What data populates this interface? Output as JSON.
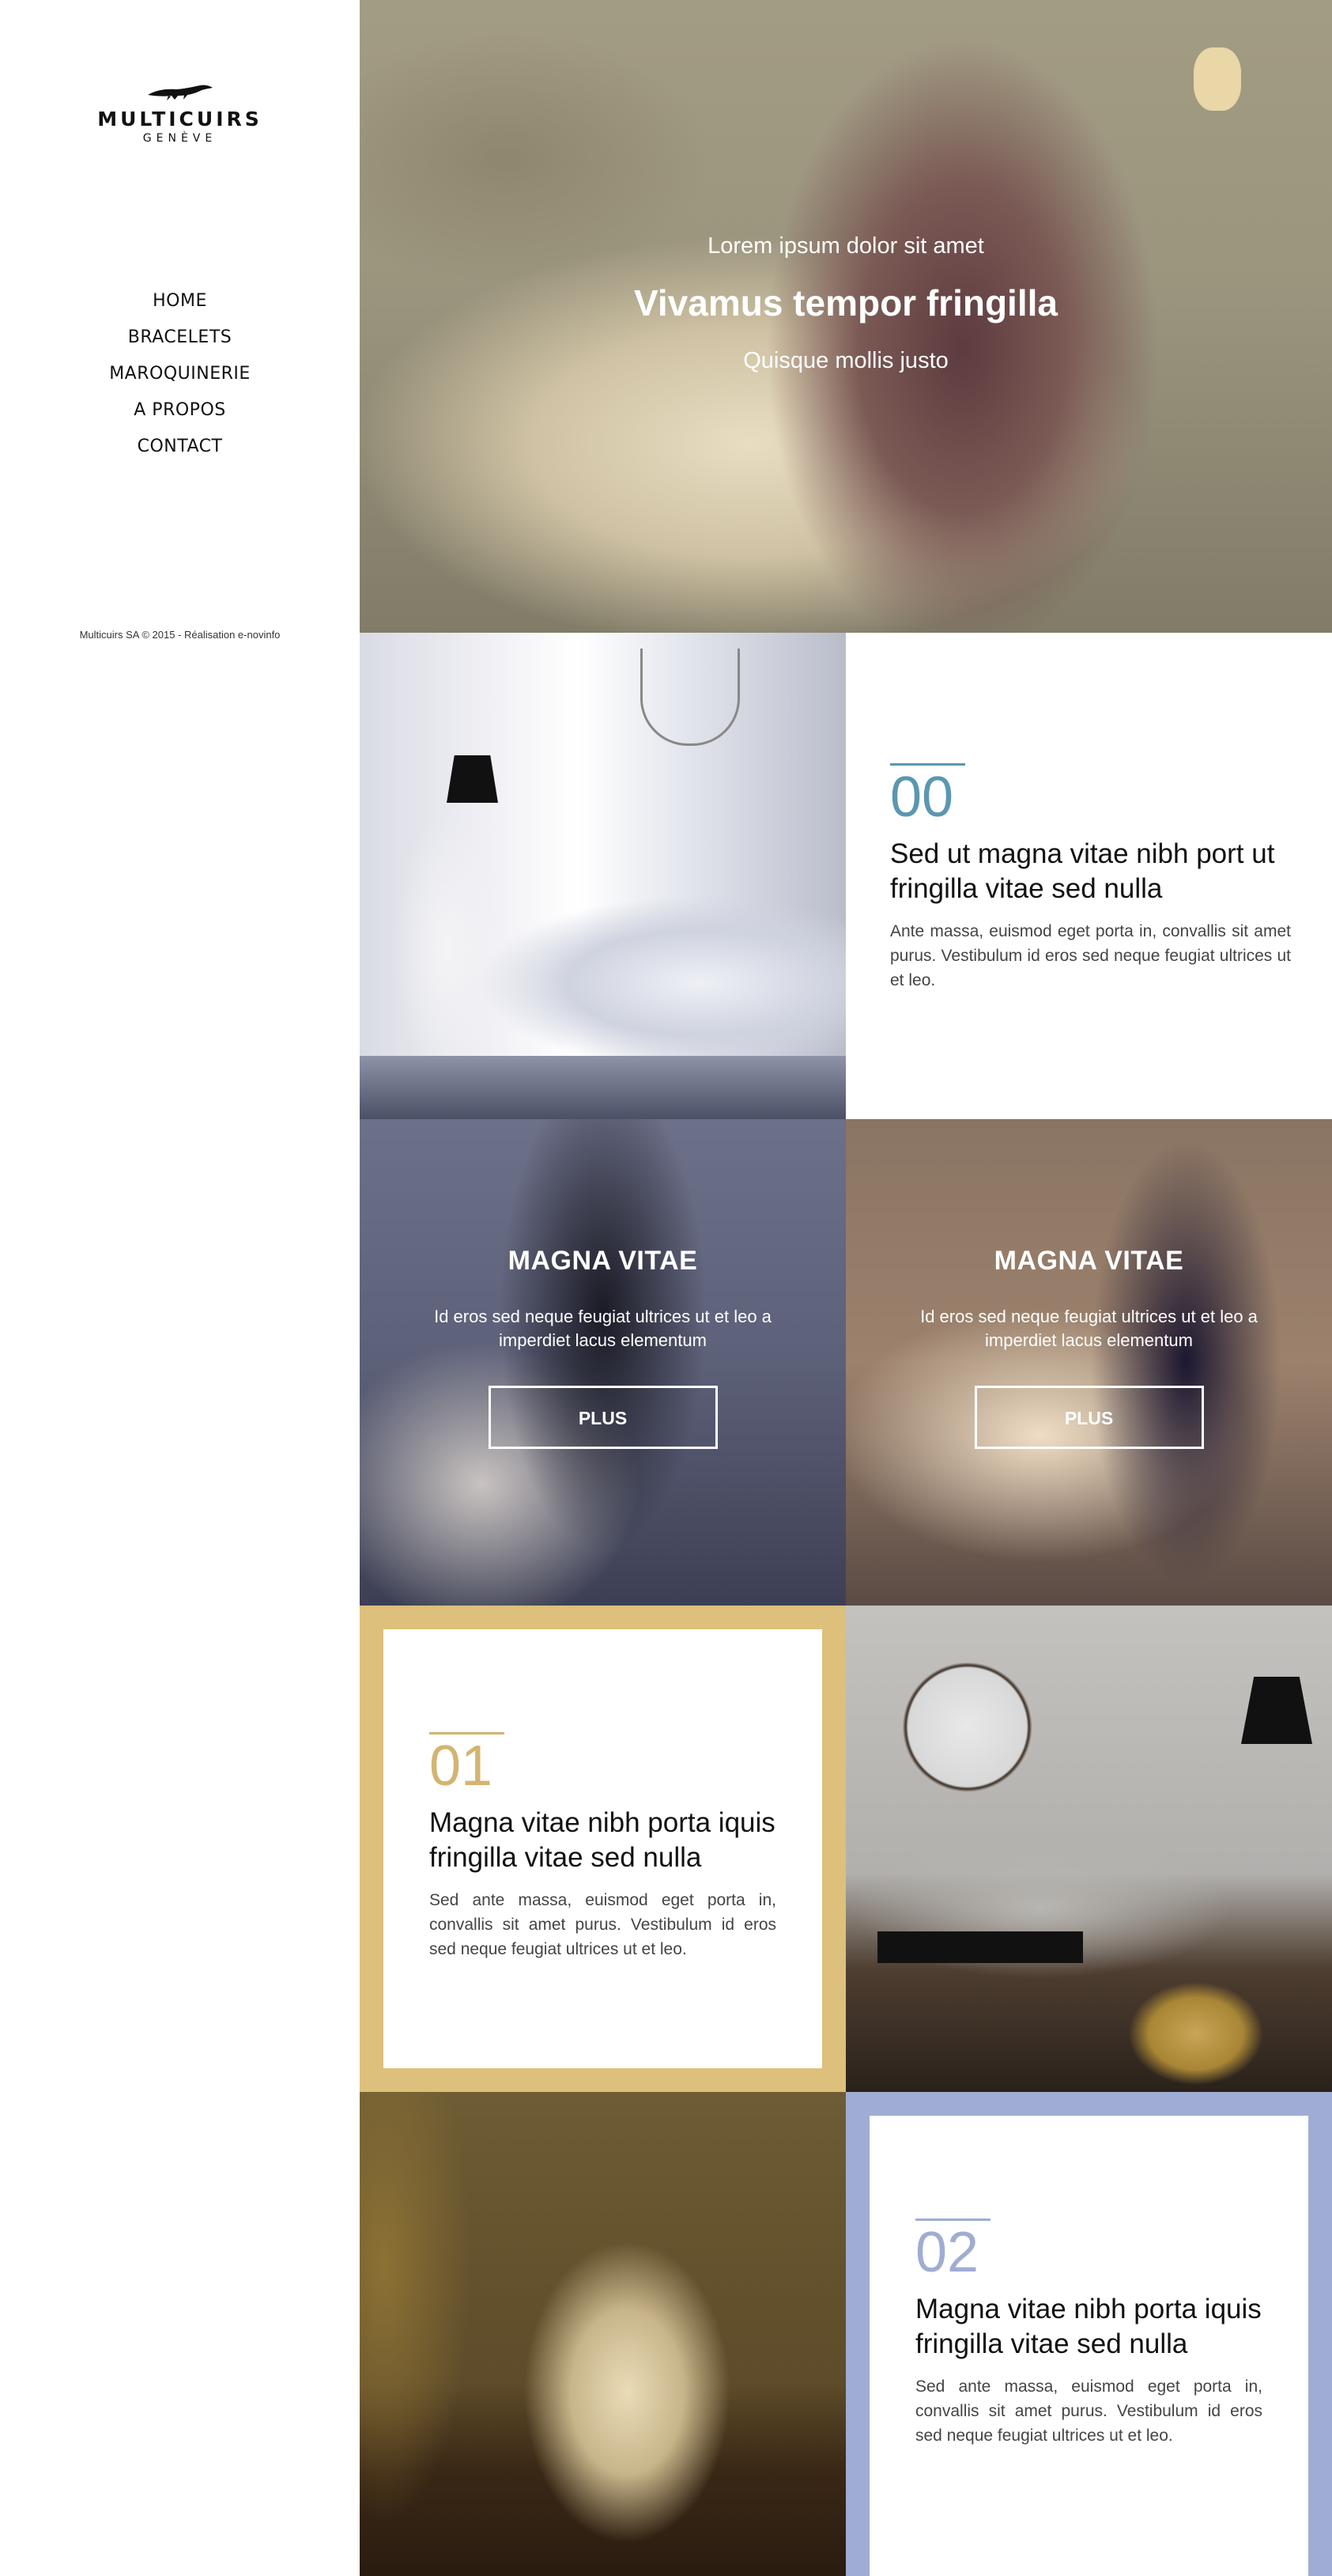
{
  "brand": {
    "name": "MULTICUIRS",
    "city": "GENÈVE",
    "logo_icon": "crocodile-icon"
  },
  "nav": {
    "items": [
      {
        "label": "HOME"
      },
      {
        "label": "BRACELETS"
      },
      {
        "label": "MAROQUINERIE"
      },
      {
        "label": "A PROPOS"
      },
      {
        "label": "CONTACT"
      }
    ]
  },
  "footer": {
    "copyright": "Multicuirs SA © 2015 - Réalisation e-novinfo"
  },
  "hero": {
    "kicker": "Lorem ipsum dolor sit amet",
    "title": "Vivamus tempor fringilla",
    "subtitle": "Quisque mollis justo"
  },
  "feature_00": {
    "number": "00",
    "title": "Sed ut magna vitae nibh port ut fringilla vitae sed nulla",
    "body": "Ante massa, euismod eget porta in, convallis sit amet purus. Vestibulum id eros sed neque feugiat ultrices ut et leo.",
    "accent": "#5b97b0"
  },
  "promos": [
    {
      "title": "MAGNA VITAE",
      "body": "Id eros sed neque feugiat ultrices ut et leo  a imperdiet lacus elementum",
      "button": "PLUS"
    },
    {
      "title": "MAGNA VITAE",
      "body": "Id eros sed neque feugiat ultrices ut et leo  a imperdiet lacus elementum",
      "button": "PLUS"
    }
  ],
  "feature_01": {
    "number": "01",
    "title": "Magna vitae nibh porta iquis fringilla vitae sed nulla",
    "body": "Sed ante massa, euismod eget porta in, convallis sit amet purus. Vestibulum id eros sed neque feugiat ultrices ut et leo.",
    "accent": "#d3b472"
  },
  "feature_02": {
    "number": "02",
    "title": "Magna vitae nibh porta iquis fringilla vitae sed nulla",
    "body": "Sed ante massa, euismod eget porta in, convallis sit amet purus. Vestibulum id eros sed neque feugiat ultrices ut et leo.",
    "accent": "#9fadd4"
  },
  "colors": {
    "gold": "#dcc07b",
    "periwinkle": "#9fadd4",
    "teal": "#5b97b0"
  }
}
